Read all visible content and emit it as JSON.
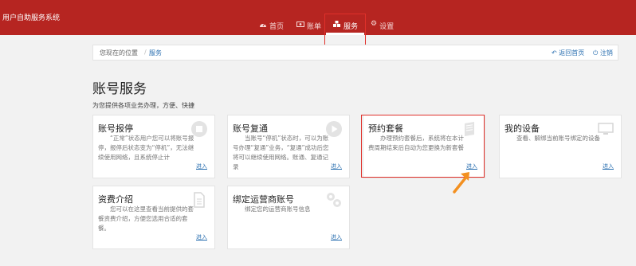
{
  "app": {
    "title": "用户自助服务系统"
  },
  "nav": {
    "items": [
      {
        "label": "首页",
        "icon": "dashboard-icon"
      },
      {
        "label": "账单",
        "icon": "bill-icon"
      },
      {
        "label": "服务",
        "icon": "services-icon",
        "active": true
      },
      {
        "label": "设置",
        "icon": "gear-icon"
      }
    ]
  },
  "breadcrumb": {
    "home": "您现在的位置",
    "separator": "/",
    "current": "服务",
    "back": "返回首页",
    "logout": "注销"
  },
  "page": {
    "title": "账号服务",
    "subtitle": "为您提供各项业务办理，方便、快捷"
  },
  "cards": [
    {
      "title": "账号报停",
      "desc": "“正常”状态用户您可以将账号报停，报停后状态变为“停机”，无法继续使用网络，且系统停止计",
      "enter": "进入",
      "icon": "stop-icon"
    },
    {
      "title": "账号复通",
      "desc": "当账号“停机”状态时，可以为账号办理“复通”业务，“复通”成功后您将可以继续使用网络。账通、复通记录",
      "enter": "进入",
      "icon": "play-icon"
    },
    {
      "title": "预约套餐",
      "desc": "办理预约套餐后，系统将在本计费周期结束后自动为您更换为新套餐",
      "enter": "进入",
      "icon": "book-icon"
    },
    {
      "title": "我的设备",
      "desc": "查看、解绑当前账号绑定的设备",
      "enter": "进入",
      "icon": "monitor-icon"
    },
    {
      "title": "资费介绍",
      "desc": "您可以在这里查看当前提供的套餐资费介绍，方便您选用合适的套餐。",
      "enter": "进入",
      "icon": "document-icon"
    },
    {
      "title": "绑定运营商账号",
      "desc": "绑定您的运营商账号信息",
      "enter": "进入",
      "icon": "link-icon"
    }
  ],
  "colors": {
    "brand": "#b62521",
    "link": "#2a6fb0",
    "highlight": "#e0302a",
    "arrow": "#f39020"
  }
}
